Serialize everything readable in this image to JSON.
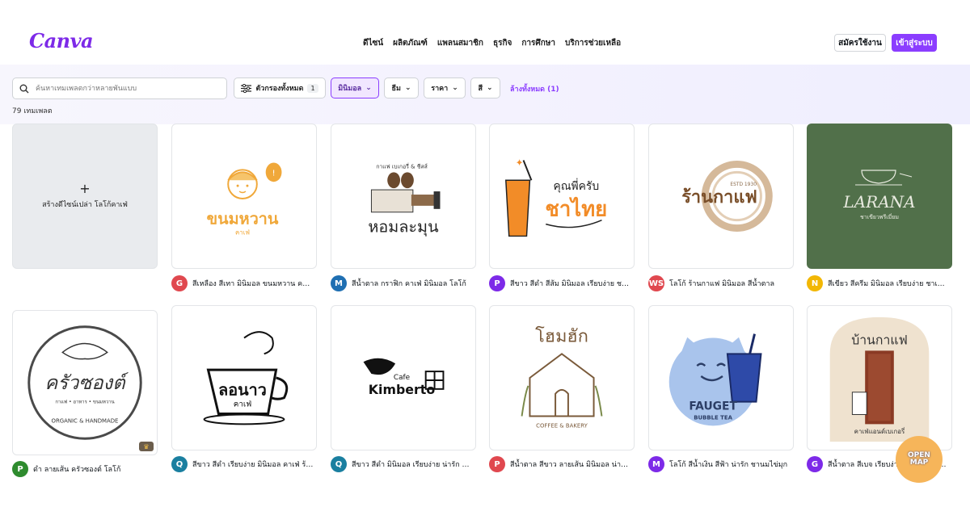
{
  "header": {
    "logo": "Canva",
    "nav": [
      "ดีไซน์",
      "ผลิตภัณฑ์",
      "แพลนสมาชิก",
      "ธุรกิจ",
      "การศึกษา",
      "บริการช่วยเหลือ"
    ],
    "signup": "สมัครใช้งาน",
    "login": "เข้าสู่ระบบ"
  },
  "filters": {
    "search_placeholder": "ค้นหาเทมเพลตกว่าหลายพันแบบ",
    "all_filters": "ตัวกรองทั้งหมด",
    "all_filters_count": "1",
    "chips": [
      "มินิมอล",
      "ธีม",
      "ราคา",
      "สี"
    ],
    "clear_all": "ล้างทั้งหมด (1)"
  },
  "result_count": "79 เทมเพลต",
  "blank_card": {
    "plus": "+",
    "label": "สร้างดีไซน์เปล่า โลโก้คาเฟ่"
  },
  "templates": [
    {
      "art_text": "ขนมหวาน",
      "art_sub": "คาเฟ่",
      "avatar": "G",
      "avatar_color": "#e0484f",
      "caption": "สีเหลือง สีเทา มินิมอล ขนมหวาน คาเฟ่ โลโก้"
    },
    {
      "art_text": "หอมละมุน",
      "art_sub": "กาแฟ เบเกอรี่ & ชีสส์",
      "avatar": "M",
      "avatar_color": "#1f6fb2",
      "caption": "สีน้ำตาล กราฟิก คาเฟ่ มินิมอล โลโก้"
    },
    {
      "art_text": "ชาไทย",
      "art_sub": "คุณพี่ครับ",
      "avatar": "P",
      "avatar_color": "#7d2ae8",
      "caption": "สีขาว สีดำ สีส้ม มินิมอล เรียบง่าย ชาไทย โลโก้"
    },
    {
      "art_text": "ร้านกาแฟ",
      "art_sub": "ESTD 1930",
      "avatar": "WS",
      "avatar_color": "#e0484f",
      "caption": "โลโก้ ร้านกาแฟ มินิมอล สีน้ำตาล"
    },
    {
      "art_text": "LARANA",
      "art_sub": "ชาเขียวพรีเมี่ยม",
      "avatar": "N",
      "avatar_color": "#f2b705",
      "caption": "สีเขียว สีครีม มินิมอล เรียบง่าย ชาเขียว โลโก้"
    },
    {
      "art_text": "ครัวซองต์",
      "art_sub": "ORGANIC & HANDMADE",
      "avatar": "P",
      "avatar_color": "#2e8b2e",
      "caption": "ดำ ลายเส้น ครัวซองต์ โลโก้"
    },
    {
      "art_text": "ลอนาว",
      "art_sub": "คาเฟ่",
      "avatar": "Q",
      "avatar_color": "#1a7fa0",
      "caption": "สีขาว สีดำ เรียบง่าย มินิมอล คาเฟ่ ร้านกาแฟ โลโก้"
    },
    {
      "art_text": "Kimberto",
      "art_sub": "Cafe",
      "avatar": "Q",
      "avatar_color": "#1a7fa0",
      "caption": "สีขาว สีดำ มินิมอล เรียบง่าย น่ารัก ร้านกาแฟ โลโก้"
    },
    {
      "art_text": "โฮมฮัก",
      "art_sub": "COFFEE & BAKERY",
      "avatar": "P",
      "avatar_color": "#e0484f",
      "caption": "สีน้ำตาล สีขาว ลายเส้น มินิมอล น่ารัก คาเฟ่ โลโก้"
    },
    {
      "art_text": "FAUGET",
      "art_sub": "BUBBLE TEA",
      "avatar": "M",
      "avatar_color": "#7d2ae8",
      "caption": "โลโก้ สีน้ำเงิน สีฟ้า น่ารัก ชานมไข่มุก"
    },
    {
      "art_text": "บ้านกาแฟ",
      "art_sub": "คาเฟ่แอนด์เบเกอรี่",
      "avatar": "G",
      "avatar_color": "#7d2ae8",
      "caption": "สีน้ำตาล สีเบจ เรียบง่าย มินิมอล บ้านกาแฟ โลโก้"
    }
  ],
  "openmap": {
    "line1": "OPEN",
    "line2": "MAP"
  },
  "icons": [
    "search-icon",
    "sliders-icon",
    "chevron-down-icon",
    "plus-icon",
    "crown-icon"
  ]
}
